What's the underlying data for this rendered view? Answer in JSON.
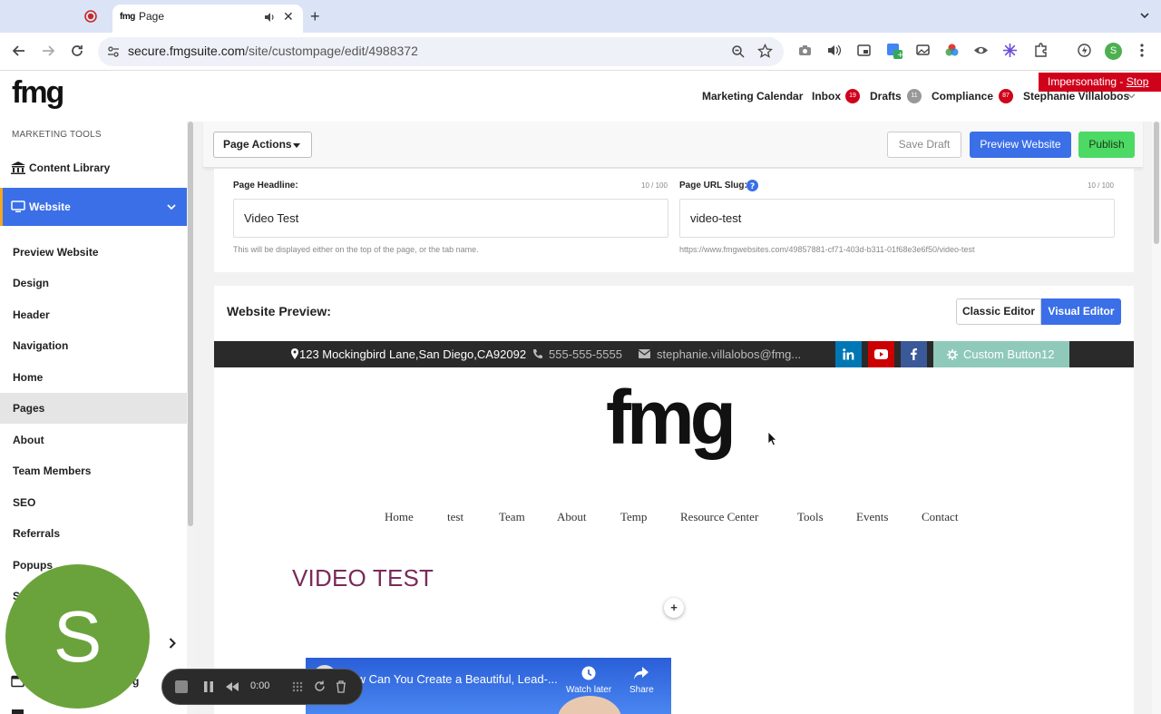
{
  "browser": {
    "tab_title": "Page",
    "tab_favicon_text": "fmg",
    "url_domain": "secure.fmgsuite.com",
    "url_path": "/site/custompage/edit/4988372",
    "profile_initial": "S"
  },
  "app": {
    "logo_text": "fmg",
    "impersonating_label": "Impersonating - ",
    "impersonating_stop": "Stop",
    "topnav": {
      "marketing_calendar": "Marketing Calendar",
      "inbox": "Inbox",
      "inbox_count": "19",
      "drafts": "Drafts",
      "drafts_count": "11",
      "compliance": "Compliance",
      "compliance_count": "87",
      "user_name": "Stephanie Villalobos"
    }
  },
  "sidebar": {
    "section_heading": "MARKETING TOOLS",
    "content_library": "Content Library",
    "website": "Website",
    "items": [
      "Preview Website",
      "Design",
      "Header",
      "Navigation",
      "Home",
      "Pages",
      "About",
      "Team Members",
      "SEO",
      "Referrals",
      "Popups"
    ],
    "partial_item": "S",
    "partial_item_2": "g"
  },
  "actions": {
    "page_actions": "Page Actions",
    "save_draft": "Save Draft",
    "preview_website": "Preview Website",
    "publish": "Publish"
  },
  "form": {
    "headline_label": "Page Headline:",
    "headline_count": "10 / 100",
    "headline_value": "Video Test",
    "headline_help": "This will be displayed either on the top of the page, or the tab name.",
    "slug_label": "Page URL Slug:",
    "slug_count": "10 / 100",
    "slug_value": "video-test",
    "slug_help": "https://www.fmgwebsites.com/49857881-cf71-403d-b311-01f68e3e6f50/video-test"
  },
  "preview": {
    "heading": "Website Preview:",
    "classic_editor": "Classic Editor",
    "visual_editor": "Visual Editor",
    "address": "123 Mockingbird Lane,San Diego,CA92092",
    "phone": "555-555-5555",
    "email": "stephanie.villalobos@fmg...",
    "custom_button": "Custom Button12",
    "site_logo": "fmg",
    "site_nav": [
      "Home",
      "test",
      "Team",
      "About",
      "Temp",
      "Resource Center",
      "Tools",
      "Events",
      "Contact"
    ],
    "page_title": "VIDEO TEST",
    "add_block": "+",
    "video_title": "How Can You Create a Beautiful, Lead-...",
    "watch_later": "Watch later",
    "share": "Share"
  },
  "overlay": {
    "avatar_initial": "S",
    "rec_time": "0:00"
  },
  "colors": {
    "primary_blue": "#3b6fe8",
    "publish_green": "#4cd964",
    "impersonate_red": "#d0021b",
    "title_purple": "#7a2a5a"
  }
}
